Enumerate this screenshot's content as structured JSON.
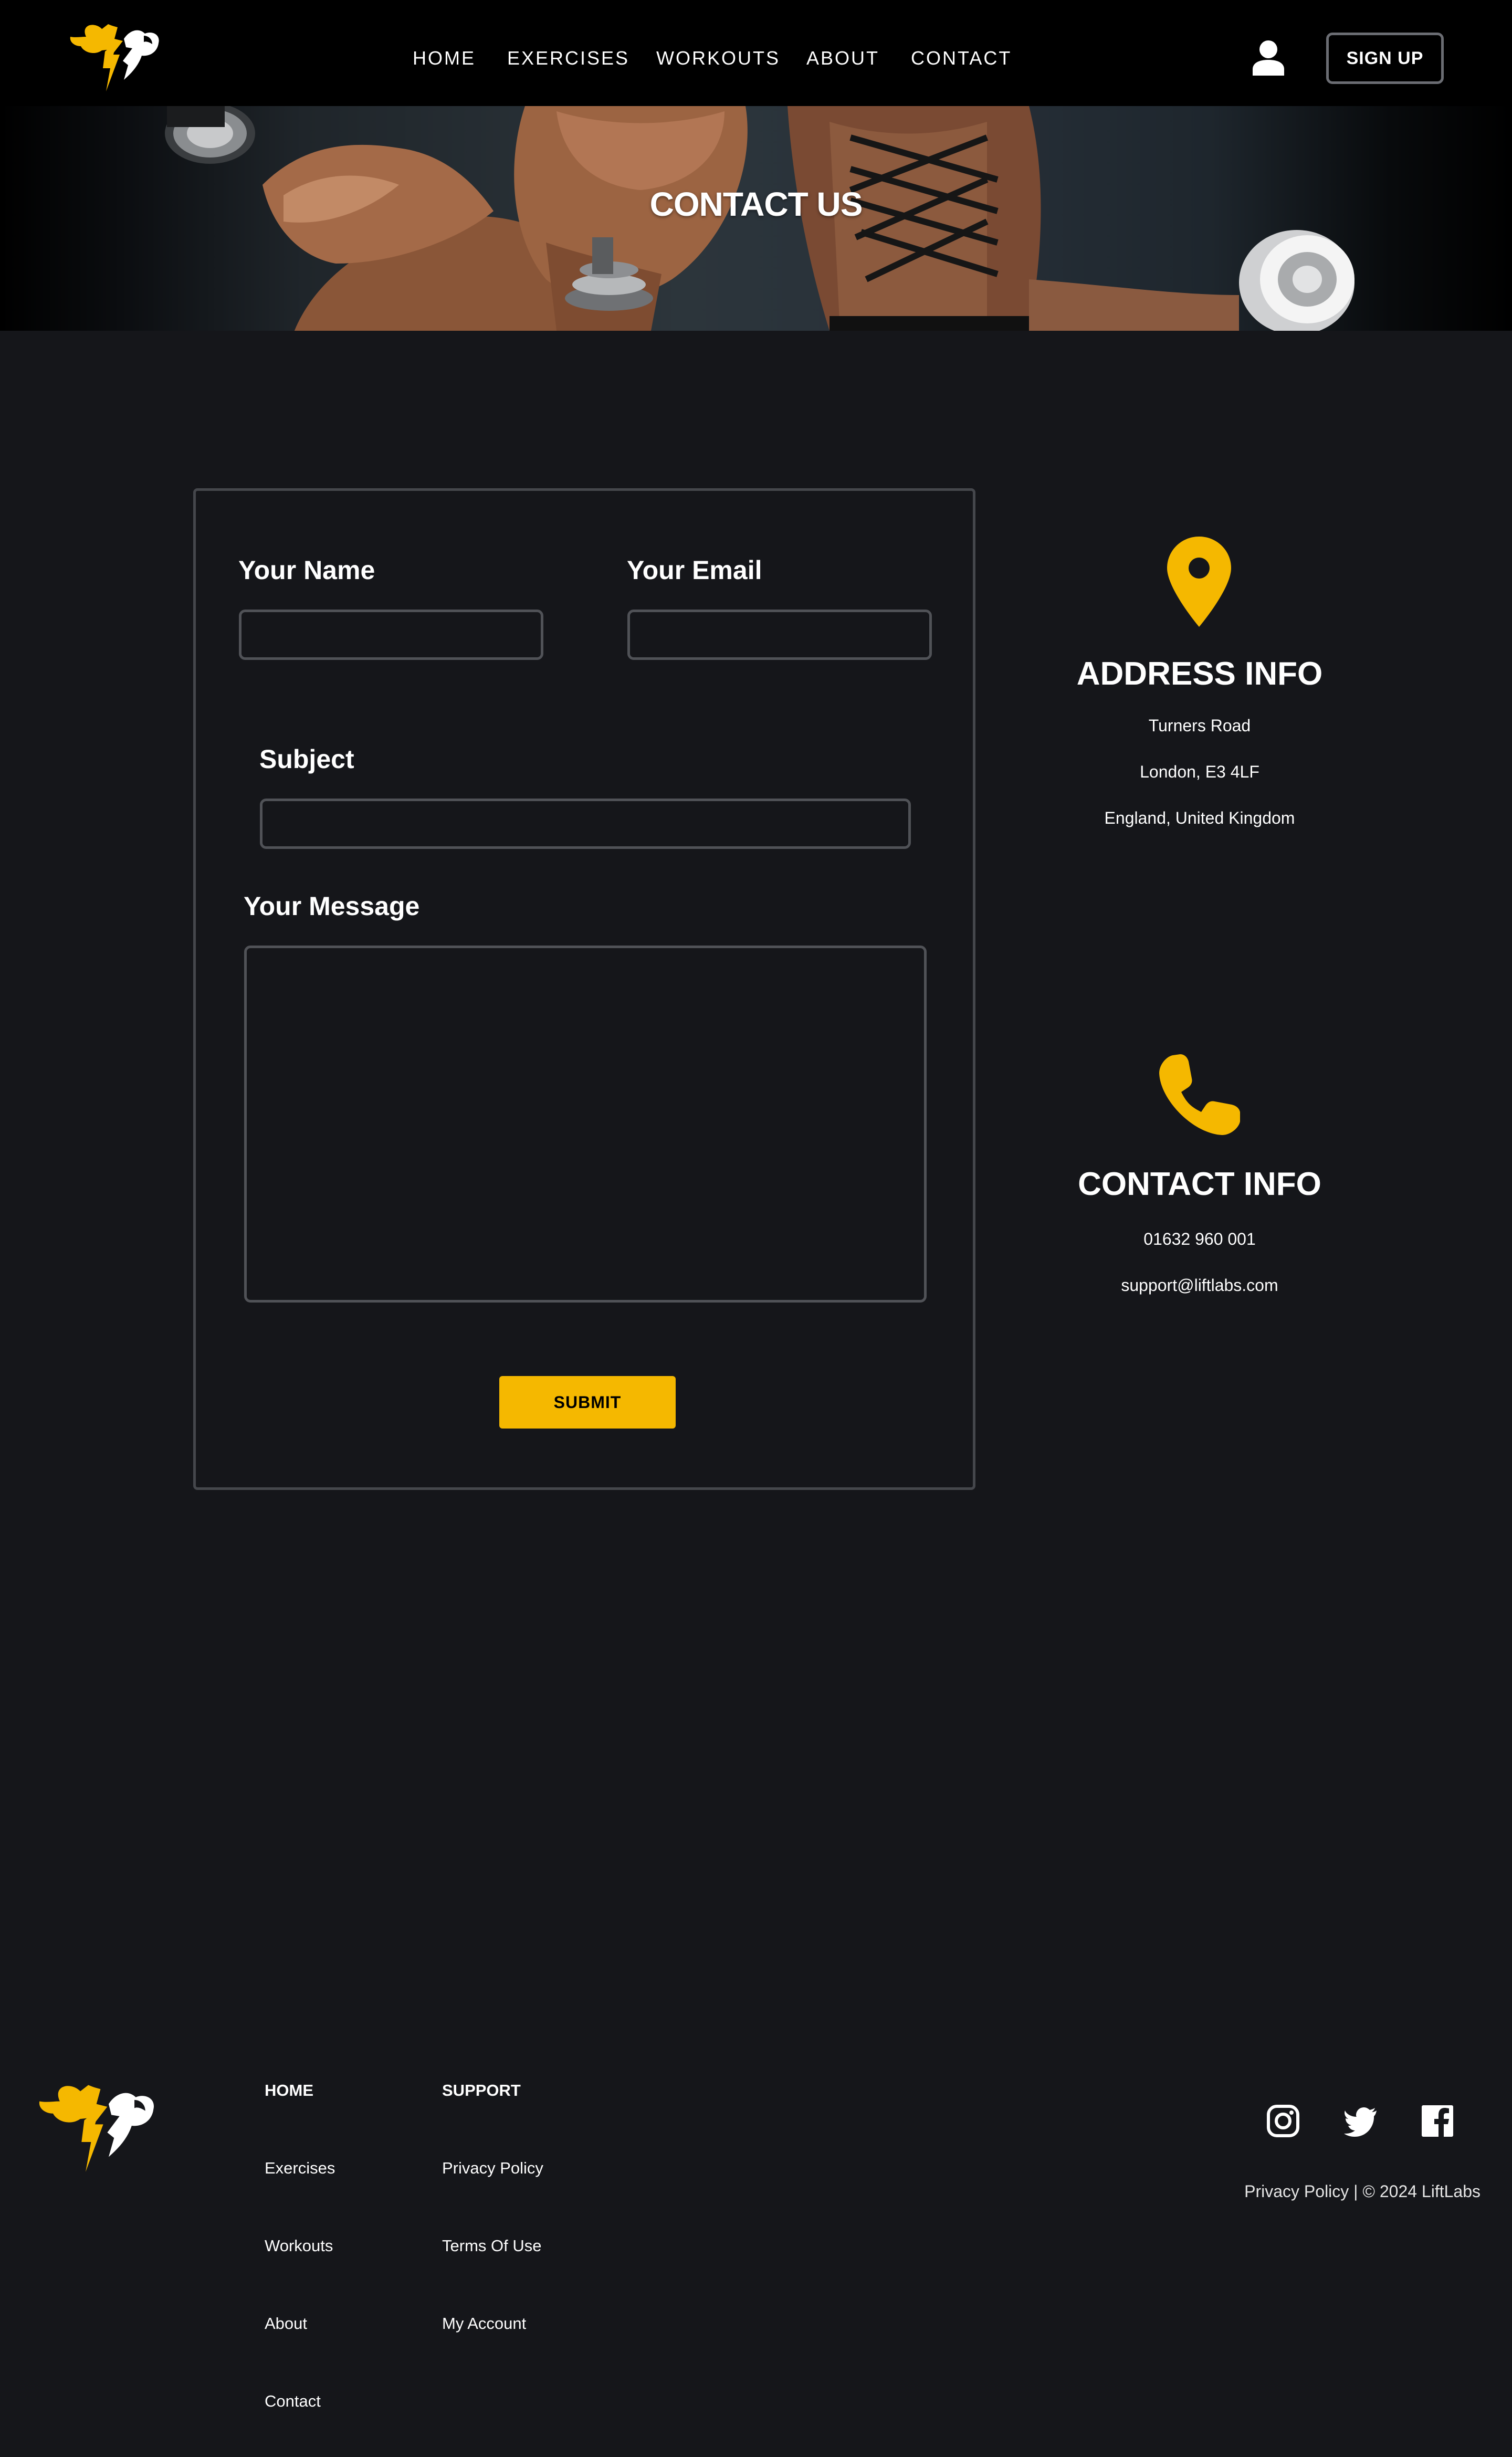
{
  "colors": {
    "accent": "#f5b800",
    "background": "#15161a",
    "navbar": "#000000",
    "border": "#505257"
  },
  "nav": {
    "logo_icon": "muscle-lightning-logo",
    "links": [
      "HOME",
      "EXERCISES",
      "WORKOUTS",
      "ABOUT",
      "CONTACT"
    ],
    "user_icon": "user-icon",
    "signup_label": "SIGN UP"
  },
  "hero": {
    "title": "CONTACT US"
  },
  "form": {
    "name_label": "Your Name",
    "name_value": "",
    "email_label": "Your Email",
    "email_value": "",
    "subject_label": "Subject",
    "subject_value": "",
    "message_label": "Your Message",
    "message_value": "",
    "submit_label": "SUBMIT"
  },
  "address": {
    "icon": "location-pin-icon",
    "title": "ADDRESS INFO",
    "lines": [
      "Turners Road",
      "London, E3 4LF",
      "England, United Kingdom"
    ]
  },
  "contact": {
    "icon": "phone-icon",
    "title": "CONTACT INFO",
    "lines": [
      "01632 960 001",
      "support@liftlabs.com"
    ]
  },
  "footer": {
    "col1": {
      "heading": "HOME",
      "links": [
        "Exercises",
        "Workouts",
        "About",
        "Contact"
      ]
    },
    "col2": {
      "heading": "SUPPORT",
      "links": [
        "Privacy Policy",
        "Terms Of Use",
        "My Account"
      ]
    },
    "social_icons": [
      "instagram-icon",
      "twitter-icon",
      "facebook-icon"
    ],
    "copyright": "Privacy Policy | © 2024 LiftLabs"
  }
}
